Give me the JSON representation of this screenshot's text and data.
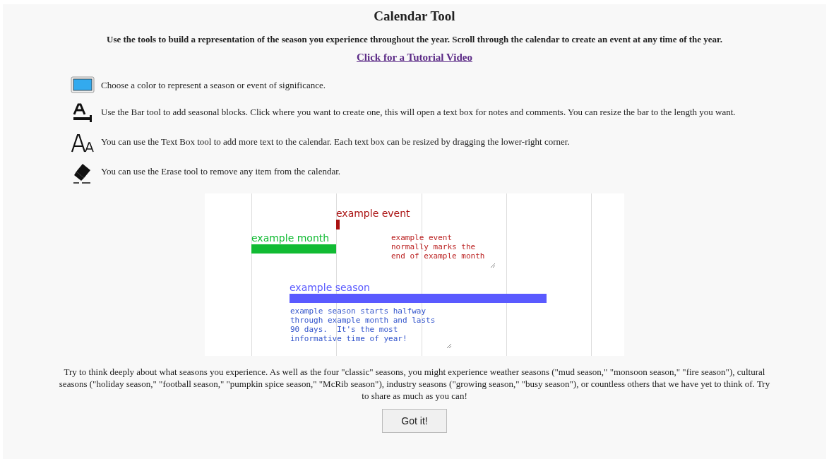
{
  "title": "Calendar Tool",
  "intro": "Use the tools to build a representation of the season you experience throughout the year. Scroll through the calendar to create an event at any time of the year.",
  "tutorial_link": "Click for a Tutorial Video",
  "tools": [
    {
      "kind": "color",
      "text": "Choose a color to represent a season or event of significance."
    },
    {
      "kind": "bar",
      "text": "Use the Bar tool to add seasonal blocks. Click where you want to create one, this will open a text box for notes and comments. You can resize the bar to the length you want."
    },
    {
      "kind": "textbox",
      "text": "You can use the Text Box tool to add more text to the calendar. Each text box can be resized by dragging the lower-right corner."
    },
    {
      "kind": "erase",
      "text": "You can use the Erase tool to remove any item from the calendar."
    }
  ],
  "example": {
    "items": [
      {
        "kind": "event",
        "label": "example event",
        "color": "#aa1111"
      },
      {
        "kind": "bar",
        "label": "example month",
        "color": "#11bb33"
      },
      {
        "kind": "note",
        "text": "example event\nnormally marks the\nend of example month",
        "color": "#bb2222"
      },
      {
        "kind": "bar",
        "label": "example season",
        "color": "#5a5aff"
      },
      {
        "kind": "note",
        "text": "example season starts halfway\nthrough example month and lasts\n90 days.  It's the most\ninformative time of year!",
        "color": "#3355cc"
      }
    ]
  },
  "footer": "Try to think deeply about what seasons you experience. As well as the four \"classic\" seasons, you might experience weather seasons (\"mud season,\" \"monsoon season,\" \"fire season\"), cultural seasons (\"holiday season,\" \"football season,\" \"pumpkin spice season,\" \"McRib season\"), industry seasons (\"growing season,\" \"busy season\"), or countless others that we have yet to think of. Try to share as much as you can!",
  "button": "Got it!"
}
